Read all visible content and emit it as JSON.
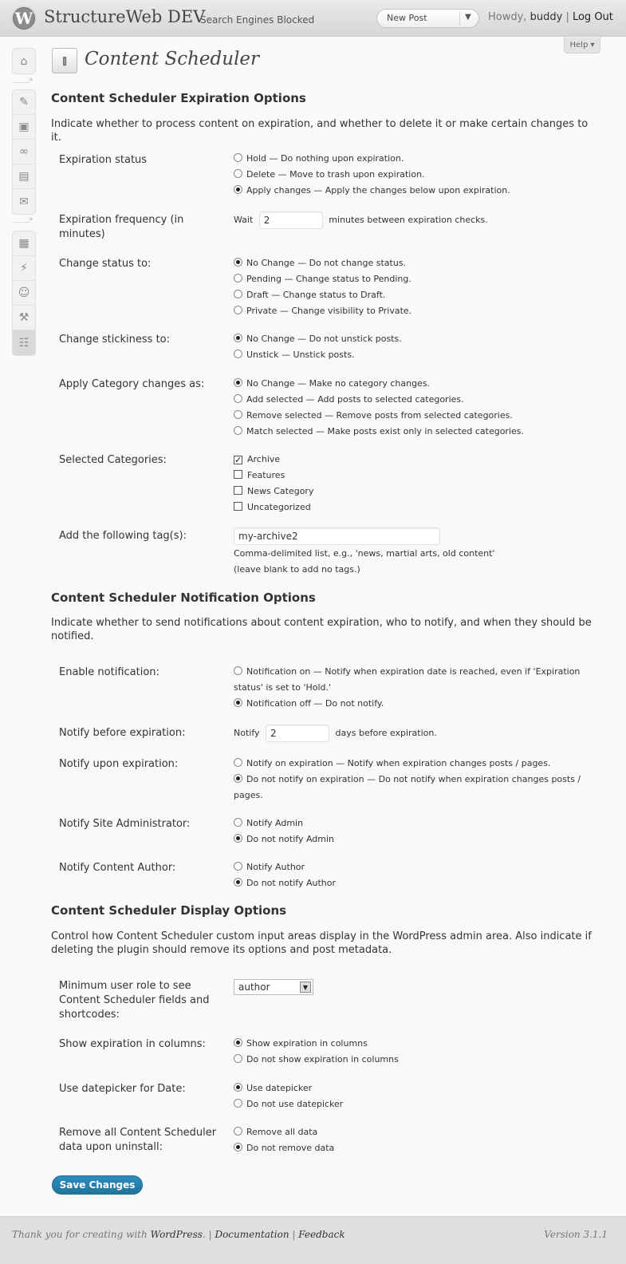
{
  "header": {
    "logo_glyph": "W",
    "site_title": "StructureWeb DEV",
    "site_subtitle": "Search Engines Blocked",
    "new_post": "New Post",
    "howdy": "Howdy,",
    "user": "buddy",
    "separator": "|",
    "logout": "Log Out"
  },
  "help": "Help ▾",
  "page_title": "Content Scheduler",
  "expiration": {
    "title": "Content Scheduler Expiration Options",
    "description": "Indicate whether to process content on expiration, and whether to delete it or make certain changes to it.",
    "status_label": "Expiration status",
    "status_options": [
      "Hold — Do nothing upon expiration.",
      "Delete — Move to trash upon expiration.",
      "Apply changes — Apply the changes below upon expiration."
    ],
    "frequency_label": "Expiration frequency (in minutes)",
    "frequency_prefix": "Wait",
    "frequency_value": "2",
    "frequency_suffix": "minutes between expiration checks.",
    "change_status_label": "Change status to:",
    "change_status_options": [
      "No Change — Do not change status.",
      "Pending — Change status to Pending.",
      "Draft — Change status to Draft.",
      "Private — Change visibility to Private."
    ],
    "stickiness_label": "Change stickiness to:",
    "stickiness_options": [
      "No Change — Do not unstick posts.",
      "Unstick — Unstick posts."
    ],
    "category_label": "Apply Category changes as:",
    "category_options": [
      "No Change — Make no category changes.",
      "Add selected — Add posts to selected categories.",
      "Remove selected — Remove posts from selected categories.",
      "Match selected — Make posts exist only in selected categories."
    ],
    "selected_categories_label": "Selected Categories:",
    "categories": [
      "Archive",
      "Features",
      "News Category",
      "Uncategorized"
    ],
    "tags_label": "Add the following tag(s):",
    "tags_value": "my-archive2",
    "tags_help": "Comma-delimited list, e.g., 'news, martial arts, old content'",
    "tags_help2": "(leave blank to add no tags.)"
  },
  "notification": {
    "title": "Content Scheduler Notification Options",
    "description": "Indicate whether to send notifications about content expiration, who to notify, and when they should be notified.",
    "enable_label": "Enable notification:",
    "enable_options": [
      "Notification on — Notify when expiration date is reached, even if 'Expiration status' is set to 'Hold.'",
      "Notification off — Do not notify."
    ],
    "before_label": "Notify before expiration:",
    "before_prefix": "Notify",
    "before_value": "2",
    "before_suffix": "days before expiration.",
    "upon_label": "Notify upon expiration:",
    "upon_options": [
      "Notify on expiration — Notify when expiration changes posts / pages.",
      "Do not notify on expiration — Do not notify when expiration changes posts / pages."
    ],
    "admin_label": "Notify Site Administrator:",
    "admin_options": [
      "Notify Admin",
      "Do not notify Admin"
    ],
    "author_label": "Notify Content Author:",
    "author_options": [
      "Notify Author",
      "Do not notify Author"
    ]
  },
  "display": {
    "title": "Content Scheduler Display Options",
    "description": "Control how Content Scheduler custom input areas display in the WordPress admin area. Also indicate if deleting the plugin should remove its options and post metadata.",
    "role_label": "Minimum user role to see Content Scheduler fields and shortcodes:",
    "role_value": "author",
    "columns_label": "Show expiration in columns:",
    "columns_options": [
      "Show expiration in columns",
      "Do not show expiration in columns"
    ],
    "datepicker_label": "Use datepicker for Date:",
    "datepicker_options": [
      "Use datepicker",
      "Do not use datepicker"
    ],
    "uninstall_label": "Remove all Content Scheduler data upon uninstall:",
    "uninstall_options": [
      "Remove all data",
      "Do not remove data"
    ]
  },
  "save_label": "Save Changes",
  "footer": {
    "thanks": "Thank you for creating with",
    "wordpress": "WordPress",
    "documentation": "Documentation",
    "feedback": "Feedback",
    "version": "Version 3.1.1"
  },
  "colors": {
    "accent": "#21759b",
    "header_bg": "#d6d6d6",
    "page_bg": "#f9f9f9"
  }
}
